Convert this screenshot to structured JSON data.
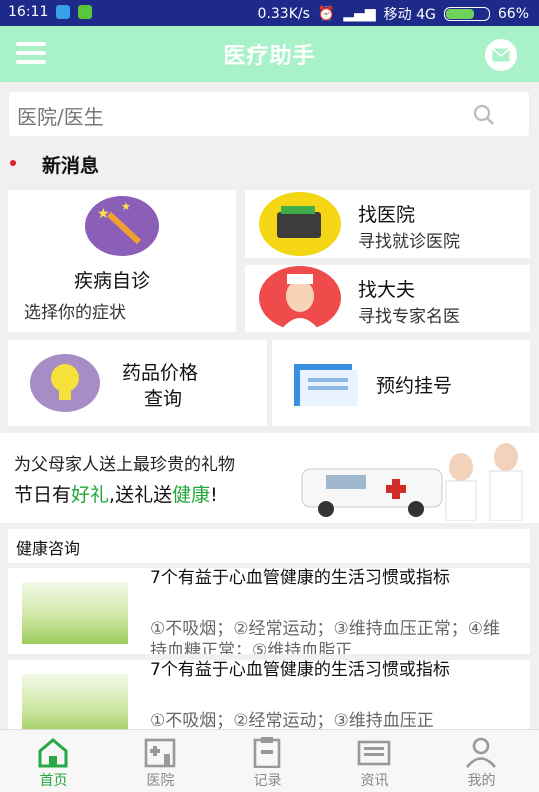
{
  "status_bar": {
    "time": "16:11",
    "speed": "0.33K/s",
    "carrier": "移动 4G",
    "battery": "66%",
    "battery_level": 0.66
  },
  "app_bar": {
    "title": "医疗助手",
    "menu_icon": "hamburger-menu-icon",
    "mail_icon": "mail-icon"
  },
  "search": {
    "placeholder": "医院/医生",
    "icon": "search-icon"
  },
  "news": {
    "title": "新消息"
  },
  "features": {
    "disease": {
      "title": "疾病自诊",
      "subtitle": "选择你的症状",
      "icon": "magic-wand-icon"
    },
    "hospital": {
      "title": "找医院",
      "subtitle": "寻找就诊医院",
      "icon": "wallet-icon"
    },
    "doctor": {
      "title": "找大夫",
      "subtitle": "寻找专家名医",
      "icon": "nurse-icon"
    },
    "drug": {
      "title_line1": "药品价格",
      "title_line2": "查询",
      "icon": "lightbulb-icon"
    },
    "register": {
      "title": "预约挂号",
      "icon": "folder-icon"
    }
  },
  "banner": {
    "line1": "为父母家人送上最珍贵的礼物",
    "line2_a": "节日有",
    "line2_b": "好礼",
    "line2_c": ",送礼送",
    "line2_d": "健康",
    "line2_e": "!"
  },
  "health": {
    "section_title": "健康咨询",
    "articles": [
      {
        "title": "7个有益于心血管健康的生活习惯或指标",
        "summary": "①不吸烟；②经常运动；③维持血压正常；④维持血糖正常；⑤维持血脂正"
      },
      {
        "title": "7个有益于心血管健康的生活习惯或指标",
        "summary": "①不吸烟；②经常运动；③维持血压正"
      }
    ]
  },
  "tabs": [
    {
      "label": "首页",
      "icon": "home-icon",
      "active": true
    },
    {
      "label": "医院",
      "icon": "hospital-icon",
      "active": false
    },
    {
      "label": "记录",
      "icon": "clipboard-icon",
      "active": false
    },
    {
      "label": "资讯",
      "icon": "news-icon",
      "active": false
    },
    {
      "label": "我的",
      "icon": "user-icon",
      "active": false
    }
  ],
  "colors": {
    "accent": "#a9f1c8",
    "active_tab": "#27a844",
    "status_bar": "#1d2a8a"
  }
}
